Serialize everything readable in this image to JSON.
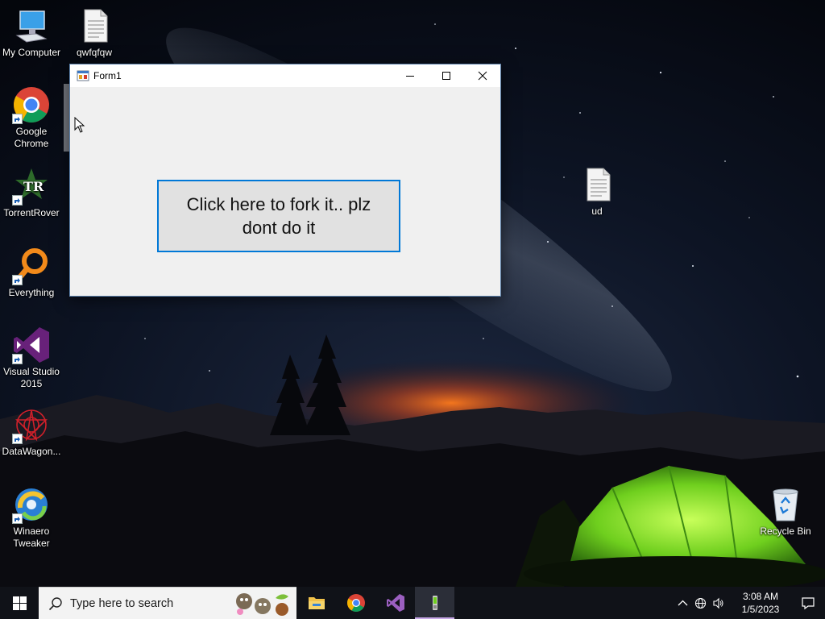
{
  "desktop": {
    "icons_left": [
      {
        "label": "My Computer"
      },
      {
        "label": "Google\nChrome"
      },
      {
        "label": "TorrentRover"
      },
      {
        "label": "Everything"
      },
      {
        "label": "Visual Studio\n2015"
      },
      {
        "label": "DataWagon..."
      },
      {
        "label": "Winaero\nTweaker"
      }
    ],
    "icon_file_top": {
      "label": "qwfqfqw"
    },
    "icon_file_right": {
      "label": "ud"
    },
    "icon_recycle": {
      "label": "Recycle Bin"
    }
  },
  "window": {
    "title": "Form1",
    "button_label": "Click here to fork it.. plz dont do it"
  },
  "taskbar": {
    "search_placeholder": "Type here to search",
    "time": "3:08 AM",
    "date": "1/5/2023"
  },
  "colors": {
    "accent": "#0078d7",
    "taskbar": "#101218",
    "window_bg": "#f0f0f0"
  }
}
